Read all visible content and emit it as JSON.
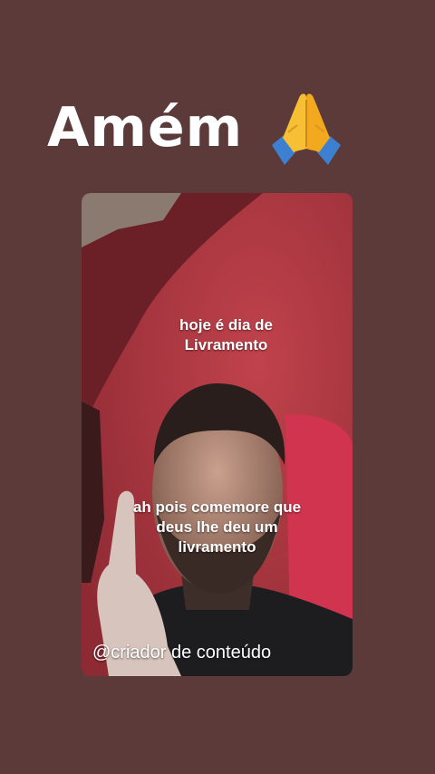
{
  "story": {
    "title": "Amém",
    "title_emoji_icon": "folded-hands-icon",
    "background_color": "#5c3a3a"
  },
  "video": {
    "caption_top": "hoje é dia de\nLivramento",
    "caption_middle": "ah pois comemore que\ndeus lhe deu um\nlivramento",
    "credit": "@criador de conteúdo",
    "accent_color": "#c8364a"
  }
}
